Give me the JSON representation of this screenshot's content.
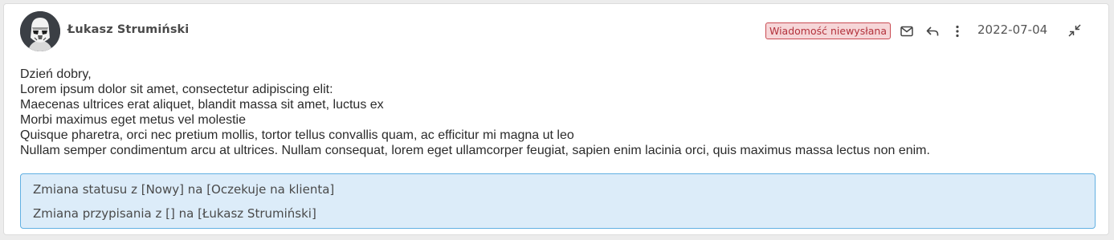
{
  "message": {
    "sender_name": "Łukasz Strumiński",
    "status_badge": "Wiadomość niewysłana",
    "date": "2022-07-04",
    "icons": {
      "mail": "envelope-icon",
      "reply": "reply-icon",
      "more": "more-vertical-icon",
      "collapse": "collapse-icon"
    },
    "body_lines": [
      "Dzień dobry,",
      "Lorem ipsum dolor sit amet, consectetur adipiscing elit:",
      "Maecenas ultrices erat aliquet, blandit massa sit amet, luctus ex",
      "Morbi maximus eget metus vel molestie",
      "Quisque pharetra, orci nec pretium mollis, tortor tellus convallis quam, ac efficitur mi magna ut leo",
      "Nullam semper condimentum arcu at ultrices. Nullam consequat, lorem eget ullamcorper feugiat, sapien enim lacinia orci, quis maximus massa lectus non enim."
    ],
    "history": [
      "Zmiana statusu z [Nowy] na [Oczekuje na klienta]",
      "Zmiana przypisania z [] na [Łukasz Strumiński]"
    ]
  },
  "colors": {
    "badge_border": "#c94a52",
    "badge_background": "#f6d6d8",
    "history_border": "#62b0e2",
    "history_background": "#dcecf9"
  }
}
